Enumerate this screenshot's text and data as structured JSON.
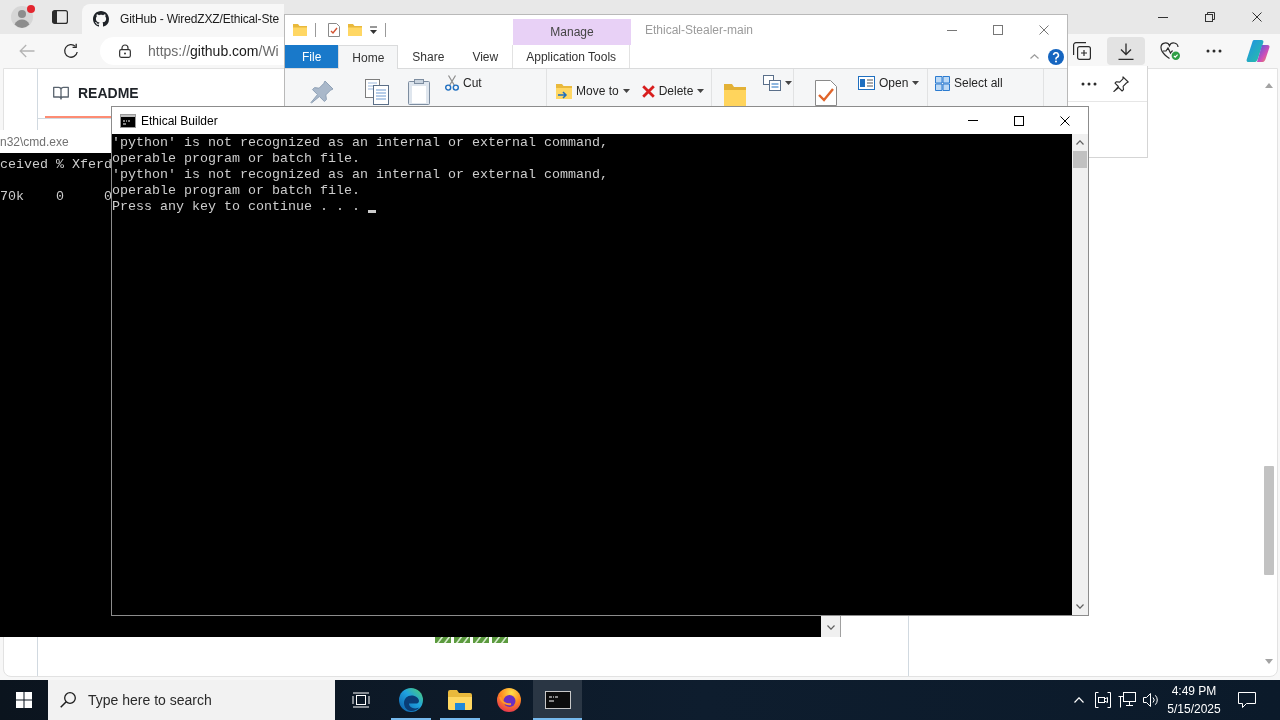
{
  "browser": {
    "profile": {
      "notification": true
    },
    "tab": {
      "title": "GitHub - WiredZXZ/Ethical-Ste",
      "selected": true
    },
    "back_disabled": true,
    "address": {
      "scheme": "https://",
      "host": "github.com",
      "path": "/Wi"
    },
    "downloads_open": true,
    "page": {
      "readme_tab": {
        "label": "README",
        "selected": true
      }
    }
  },
  "explorer": {
    "title": "Ethical-Stealer-main",
    "context_header": "Manage",
    "tabs": [
      {
        "label": "File",
        "kind": "file",
        "selected": false
      },
      {
        "label": "Home",
        "kind": "standard",
        "selected": true
      },
      {
        "label": "Share",
        "kind": "standard",
        "selected": false
      },
      {
        "label": "View",
        "kind": "standard",
        "selected": false
      },
      {
        "label": "Application Tools",
        "kind": "contextual",
        "selected": false
      }
    ],
    "ribbon": {
      "cut": {
        "label": "Cut"
      },
      "move_to": {
        "label": "Move to",
        "menu": true
      },
      "delete": {
        "label": "Delete",
        "menu": true
      },
      "copy_to": {
        "menu": true
      },
      "open": {
        "label": "Open",
        "menu": true
      },
      "select_all": {
        "label": "Select all"
      }
    }
  },
  "console_behind": {
    "title": "n32\\cmd.exe",
    "blocks": [
      [
        "ceived % Xferd"
      ],
      [
        "70k    0     0"
      ]
    ]
  },
  "console": {
    "title": "Ethical Builder",
    "lines": [
      "'python' is not recognized as an internal or external command,",
      "operable program or batch file.",
      "'python' is not recognized as an internal or external command,",
      "operable program or batch file.",
      "Press any key to continue . . ."
    ],
    "cursor": true
  },
  "taskbar": {
    "search": {
      "placeholder": "Type here to search"
    },
    "apps": [
      {
        "kind": "edge",
        "running": true,
        "selected": false
      },
      {
        "kind": "explorer",
        "running": true,
        "selected": false
      },
      {
        "kind": "firefox",
        "running": false,
        "selected": false
      },
      {
        "kind": "console",
        "running": true,
        "selected": true
      }
    ],
    "clock": {
      "time": "4:49 PM",
      "date": "5/15/2025"
    }
  }
}
